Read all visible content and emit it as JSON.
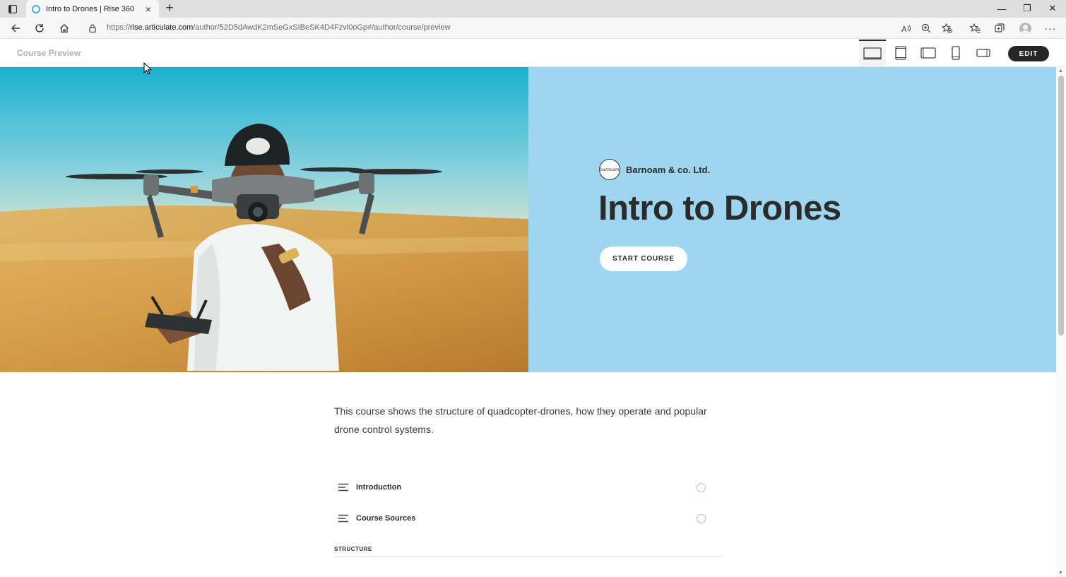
{
  "browser": {
    "tab_title": "Intro to Drones | Rise 360",
    "url_prefix": "https://",
    "url_host": "rise.articulate.com",
    "url_path": "/author/52D5dAwdK2mSeGxSIBeSK4D4Fzvl0oGp#/author/course/preview",
    "new_tab_label": "+",
    "tab_close_label": "×",
    "more_label": "···",
    "window_controls": {
      "minimize": "—",
      "restore": "❐",
      "close": "✕"
    }
  },
  "header": {
    "preview_label": "Course Preview",
    "edit_label": "EDIT",
    "devices": [
      "desktop-view",
      "tablet-portrait-view",
      "tablet-landscape-view",
      "phone-portrait-view",
      "phone-landscape-view"
    ],
    "active_device": "desktop-view"
  },
  "hero": {
    "org_logo_text": "barnoam",
    "org_name": "Barnoam & co. Ltd.",
    "title": "Intro to Drones",
    "start_label": "START COURSE",
    "panel_color": "#9dd6ee"
  },
  "course": {
    "description": "This course shows the structure of quadcopter-drones, how they operate and popular drone control systems.",
    "lessons": [
      {
        "label": "Introduction",
        "icon": "text-lesson-icon",
        "status": "not-started"
      },
      {
        "label": "Course Sources",
        "icon": "text-lesson-icon",
        "status": "not-started"
      }
    ],
    "section_title": "STRUCTURE"
  }
}
